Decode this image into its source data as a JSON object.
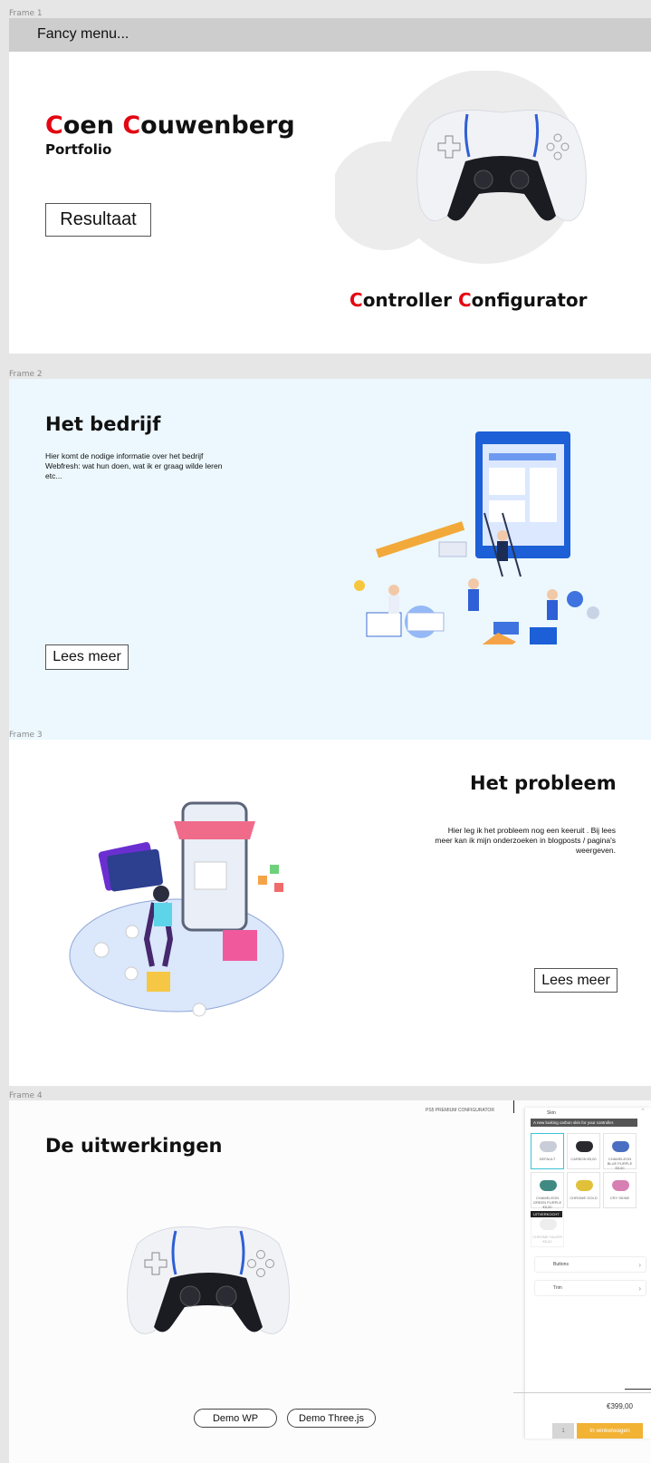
{
  "frames": {
    "f1": "Frame 1",
    "f2": "Frame 2",
    "f3": "Frame 3",
    "f4": "Frame 4"
  },
  "menu": {
    "label": "Fancy menu..."
  },
  "hero": {
    "name_first_initial": "C",
    "name_first_rest": "oen ",
    "name_last_initial": "C",
    "name_last_rest": "ouwenberg",
    "subtitle": "Portfolio",
    "button": "Resultaat",
    "project_word1_initial": "C",
    "project_word1_rest": "ontroller ",
    "project_word2_initial": "C",
    "project_word2_rest": "onfigurator"
  },
  "company": {
    "title": "Het bedrijf",
    "text": "Hier komt de nodige informatie over het bedrijf Webfresh: wat hun doen, wat ik er graag wilde leren etc...",
    "button": "Lees meer"
  },
  "problem": {
    "title": "Het probleem",
    "text": "Hier leg ik het probleem nog een keeruit . Bij lees meer kan ik mijn onderzoeken in blogposts / pagina's weergeven.",
    "button": "Lees meer"
  },
  "results": {
    "title": "De uitwerkingen",
    "demo_wp": "Demo WP",
    "demo_three": "Demo Three.js",
    "configurator": {
      "brand": "PS5 PREMIUM CONFIGURATOR",
      "section": "Skin",
      "tooltip": "A new looking carbon skin for your controller.",
      "tiles": [
        {
          "label": "DEFAULT",
          "color": "#c9cdd8"
        },
        {
          "label": "CARBON €5,00",
          "color": "#2a2a2e"
        },
        {
          "label": "CHAMELEON BLUE PURPLE €5,00",
          "color": "#4a6fc2"
        },
        {
          "label": "CHAMELEON GREEN PURPLE €5,00",
          "color": "#3f8a83"
        },
        {
          "label": "CHROME GOLD",
          "color": "#e1c13a"
        },
        {
          "label": "CRY SKINE",
          "color": "#d77fb3"
        },
        {
          "label": "CHROME SILVER €5,00",
          "color": "#d9d9d9"
        }
      ],
      "badge": "UITVERKOCHT",
      "accordion": [
        "Buttons",
        "Trim"
      ],
      "price": "€399,00",
      "qty": "1",
      "cart": "In winkelwagen"
    }
  },
  "colors": {
    "accent": "#e30613",
    "frame2_bg": "#ecf8fd",
    "cart_btn": "#f2b233"
  }
}
